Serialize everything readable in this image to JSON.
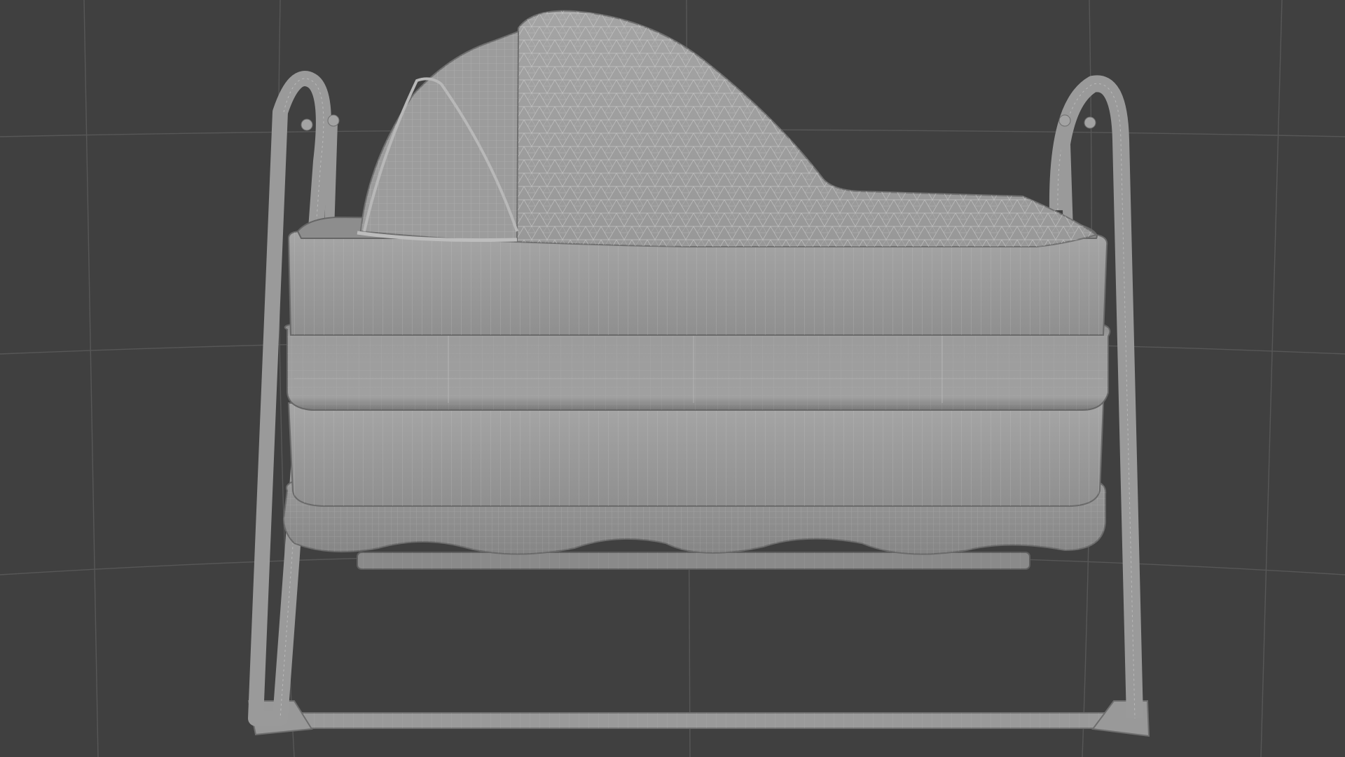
{
  "viewport": {
    "view": "wireframe-render",
    "subject": "bassinet-cradle",
    "colors": {
      "background": "#404040",
      "floor_grid": "#575757",
      "model_light": "#a2a2a2",
      "model_mid": "#8e8e8e",
      "model_shadow": "#6d6d6d",
      "wire": "#c4c4c4",
      "frame": "#9a9a9a"
    }
  }
}
